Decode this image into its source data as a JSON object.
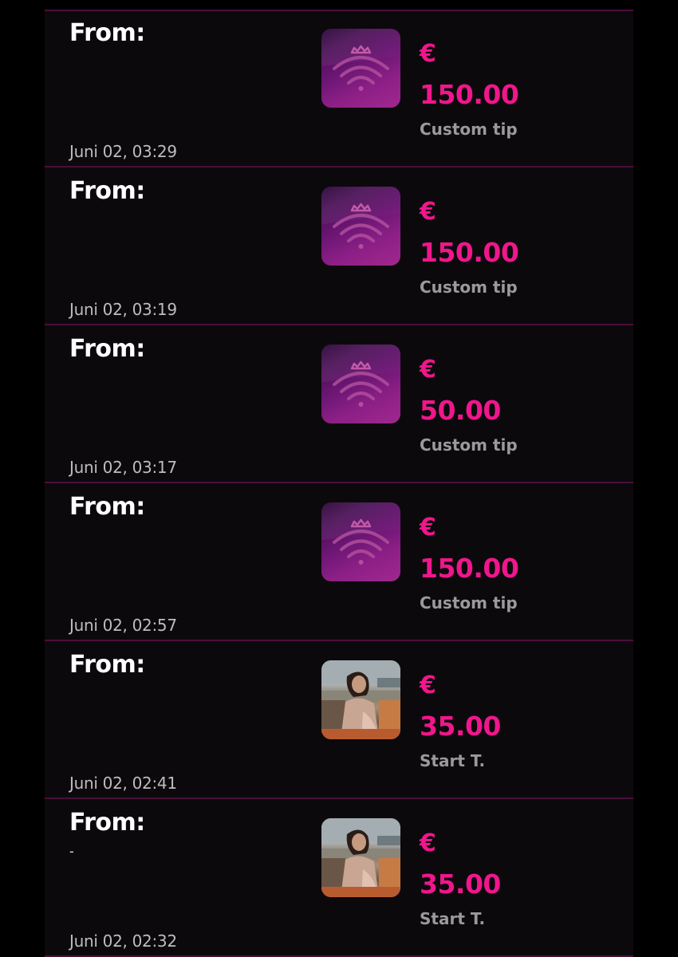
{
  "transactions": [
    {
      "from_label": "From:",
      "sender": "",
      "timestamp": "Juni 02, 03:29",
      "icon": "wifi-crown-icon",
      "currency": "€",
      "amount": "150.00",
      "type": "Custom tip"
    },
    {
      "from_label": "From:",
      "sender": "",
      "timestamp": "Juni 02, 03:19",
      "icon": "wifi-crown-icon",
      "currency": "€",
      "amount": "150.00",
      "type": "Custom tip"
    },
    {
      "from_label": "From:",
      "sender": "",
      "timestamp": "Juni 02, 03:17",
      "icon": "wifi-crown-icon",
      "currency": "€",
      "amount": "50.00",
      "type": "Custom tip"
    },
    {
      "from_label": "From:",
      "sender": "",
      "timestamp": "Juni 02, 02:57",
      "icon": "wifi-crown-icon",
      "currency": "€",
      "amount": "150.00",
      "type": "Custom tip"
    },
    {
      "from_label": "From:",
      "sender": "",
      "timestamp": "Juni 02, 02:41",
      "icon": "profile-photo",
      "currency": "€",
      "amount": "35.00",
      "type": "Start T."
    },
    {
      "from_label": "From:",
      "sender": "-",
      "timestamp": "Juni 02, 02:32",
      "icon": "profile-photo",
      "currency": "€",
      "amount": "35.00",
      "type": "Start T."
    }
  ],
  "colors": {
    "background": "#0c090c",
    "divider": "#4a0f3a",
    "accent": "#f0168c",
    "label": "#ffffff",
    "muted": "#9a9a9a"
  }
}
